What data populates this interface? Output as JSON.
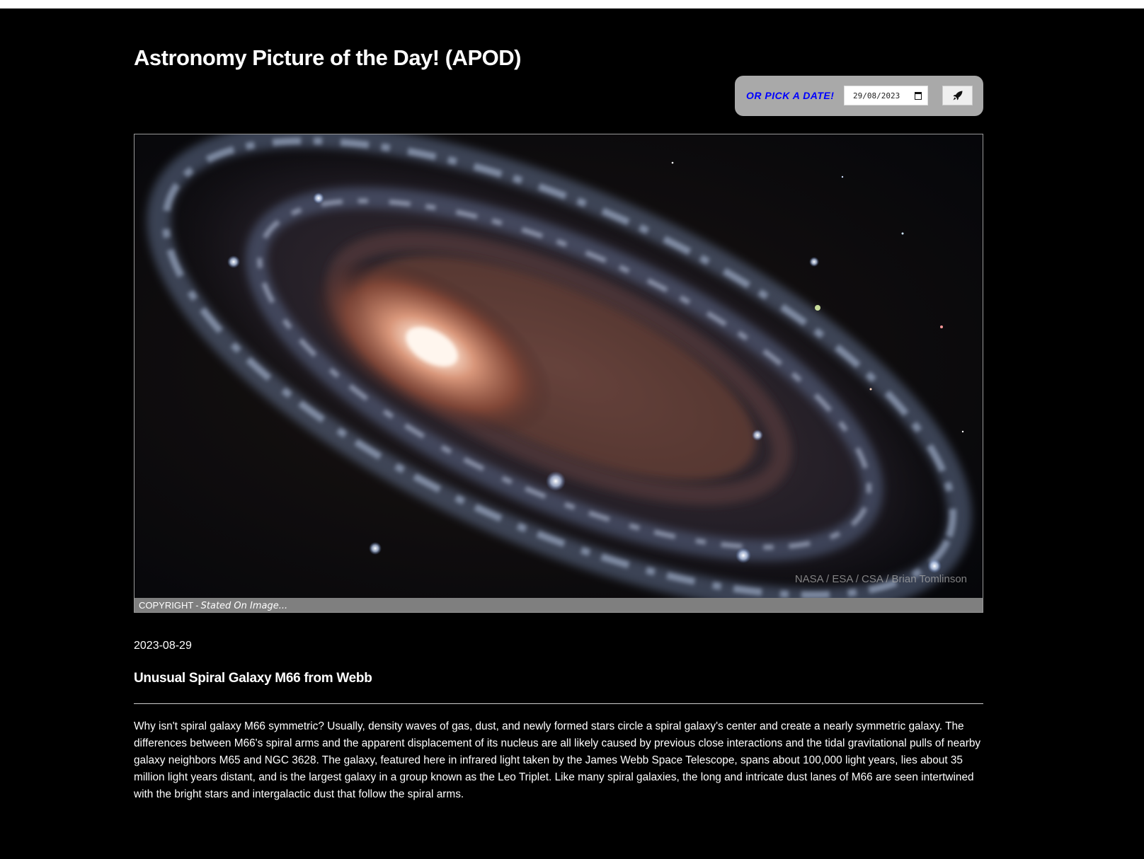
{
  "page": {
    "title": "Astronomy Picture of the Day! (APOD)"
  },
  "date_picker": {
    "label": "OR PICK A DATE!",
    "value": "29/08/2023",
    "submit_icon": "rocket-icon",
    "calendar_icon": "calendar-icon"
  },
  "apod": {
    "image_credit_overlay": "NASA / ESA / CSA / Brian Tomlinson",
    "copyright_label": "COPYRIGHT",
    "copyright_separator": "-",
    "copyright_note": "Stated On Image...",
    "date": "2023-08-29",
    "title": "Unusual Spiral Galaxy M66 from Webb",
    "explanation": "Why isn't spiral galaxy M66 symmetric? Usually, density waves of gas, dust, and newly formed stars circle a spiral galaxy's center and create a nearly symmetric galaxy. The differences between M66's spiral arms and the apparent displacement of its nucleus are all likely caused by previous close interactions and the tidal gravitational pulls of nearby galaxy neighbors M65 and NGC 3628. The galaxy, featured here in infrared light taken by the James Webb Space Telescope, spans about 100,000 light years, lies about 35 million light years distant, and is the largest galaxy in a group known as the Leo Triplet. Like many spiral galaxies, the long and intricate dust lanes of M66 are seen intertwined with the bright stars and intergalactic dust that follow the spiral arms."
  },
  "colors": {
    "background": "#000000",
    "panel": "#a9a9a9",
    "label_accent": "#0000ff",
    "copyright_bar": "#7f7f7f"
  }
}
